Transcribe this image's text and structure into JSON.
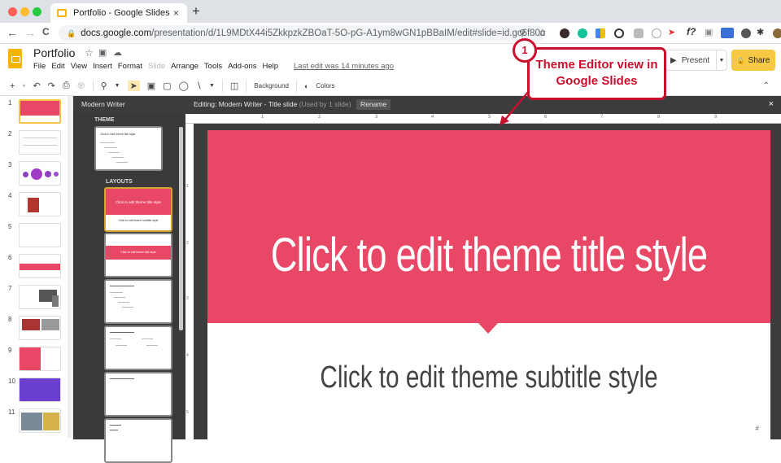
{
  "browser": {
    "tab_title": "Portfolio - Google Slides",
    "new_tab": "+",
    "close_tab": "×",
    "url_domain": "docs.google.com",
    "url_path": "/presentation/d/1L9MDtX44i5ZkkpzkZBOaT-5O-pG-A1ym8wGN1pBBaIM/edit#slide=id.gc6f80d1f...",
    "back": "←",
    "forward": "→",
    "reload": "C",
    "extensions": [
      "extension-dark",
      "grammarly",
      "google-apps",
      "extension-cc",
      "extension-shield",
      "extension-smile",
      "extension-megaphone",
      "extension-font",
      "extension-camera",
      "extension-new",
      "extension-puzzle-dark",
      "extensions-puzzle",
      "profile-avatar"
    ]
  },
  "app": {
    "doc_title": "Portfolio",
    "menus": [
      "File",
      "Edit",
      "View",
      "Insert",
      "Format",
      "Slide",
      "Arrange",
      "Tools",
      "Add-ons",
      "Help"
    ],
    "disabled_menu": "Slide",
    "last_edit": "Last edit was 14 minutes ago",
    "present_label": "Present",
    "share_label": "Share"
  },
  "toolbar": {
    "background_label": "Background",
    "colors_label": "Colors"
  },
  "filmstrip": {
    "slides": [
      {
        "num": "1",
        "style": "title-red",
        "selected": true
      },
      {
        "num": "2",
        "style": "text"
      },
      {
        "num": "3",
        "style": "circles"
      },
      {
        "num": "4",
        "style": "list-red"
      },
      {
        "num": "5",
        "style": "diagram"
      },
      {
        "num": "6",
        "style": "red-bar"
      },
      {
        "num": "7",
        "style": "devices"
      },
      {
        "num": "8",
        "style": "photos"
      },
      {
        "num": "9",
        "style": "red-square"
      },
      {
        "num": "10",
        "style": "purple"
      },
      {
        "num": "11",
        "style": "photos-2"
      }
    ]
  },
  "editor": {
    "theme_name": "Modern Writer",
    "editing_label": "Editing: Modern Writer - Title slide",
    "used_by": "(Used by 1 slide)",
    "rename_label": "Rename",
    "close": "×",
    "theme_section": "THEME",
    "layouts_section": "LAYOUTS",
    "theme_thumb_title": "Click to edit theme title style",
    "layout_title_thumb": "Click to edit theme title style",
    "layout_title_sub": "Click to edit theme subtitle style",
    "layout_section_thumb": "Click to edit theme title style",
    "ruler_h": [
      "1",
      "2",
      "3",
      "4",
      "5",
      "6",
      "7",
      "8",
      "9"
    ],
    "ruler_v": [
      "1",
      "2",
      "3",
      "4",
      "5"
    ]
  },
  "slide": {
    "title": "Click to edit theme title style",
    "subtitle": "Click to edit theme subtitle style",
    "slide_number": "#",
    "accent_color": "#e84866"
  },
  "annotation": {
    "badge": "1",
    "text_line1": "Theme Editor view in",
    "text_line2": "Google Slides",
    "color": "#c8102e"
  }
}
